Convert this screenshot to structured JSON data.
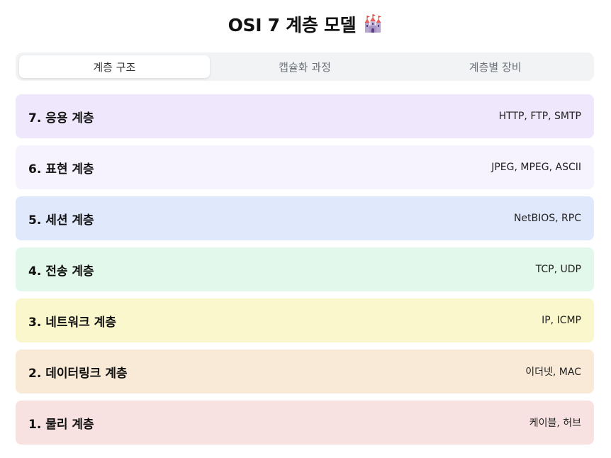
{
  "header": {
    "title": "OSI 7 계층 모델",
    "icon": "castle-icon"
  },
  "tabs": [
    {
      "label": "계층 구조",
      "active": true
    },
    {
      "label": "캡슐화 과정",
      "active": false
    },
    {
      "label": "계층별 장비",
      "active": false
    }
  ],
  "layers": [
    {
      "name": "7. 응용 계층",
      "protocols": "HTTP, FTP, SMTP",
      "color": "#efe8fd"
    },
    {
      "name": "6. 표현 계층",
      "protocols": "JPEG, MPEG, ASCII",
      "color": "#f6f3fe"
    },
    {
      "name": "5. 세션 계층",
      "protocols": "NetBIOS, RPC",
      "color": "#e0e9fb"
    },
    {
      "name": "4. 전송 계층",
      "protocols": "TCP, UDP",
      "color": "#e1f8ea"
    },
    {
      "name": "3. 네트워크 계층",
      "protocols": "IP, ICMP",
      "color": "#fbf7cc"
    },
    {
      "name": "2. 데이터링크 계층",
      "protocols": "이더넷, MAC",
      "color": "#f8ead6"
    },
    {
      "name": "1. 물리 계층",
      "protocols": "케이블, 허브",
      "color": "#f8e2e1"
    }
  ]
}
